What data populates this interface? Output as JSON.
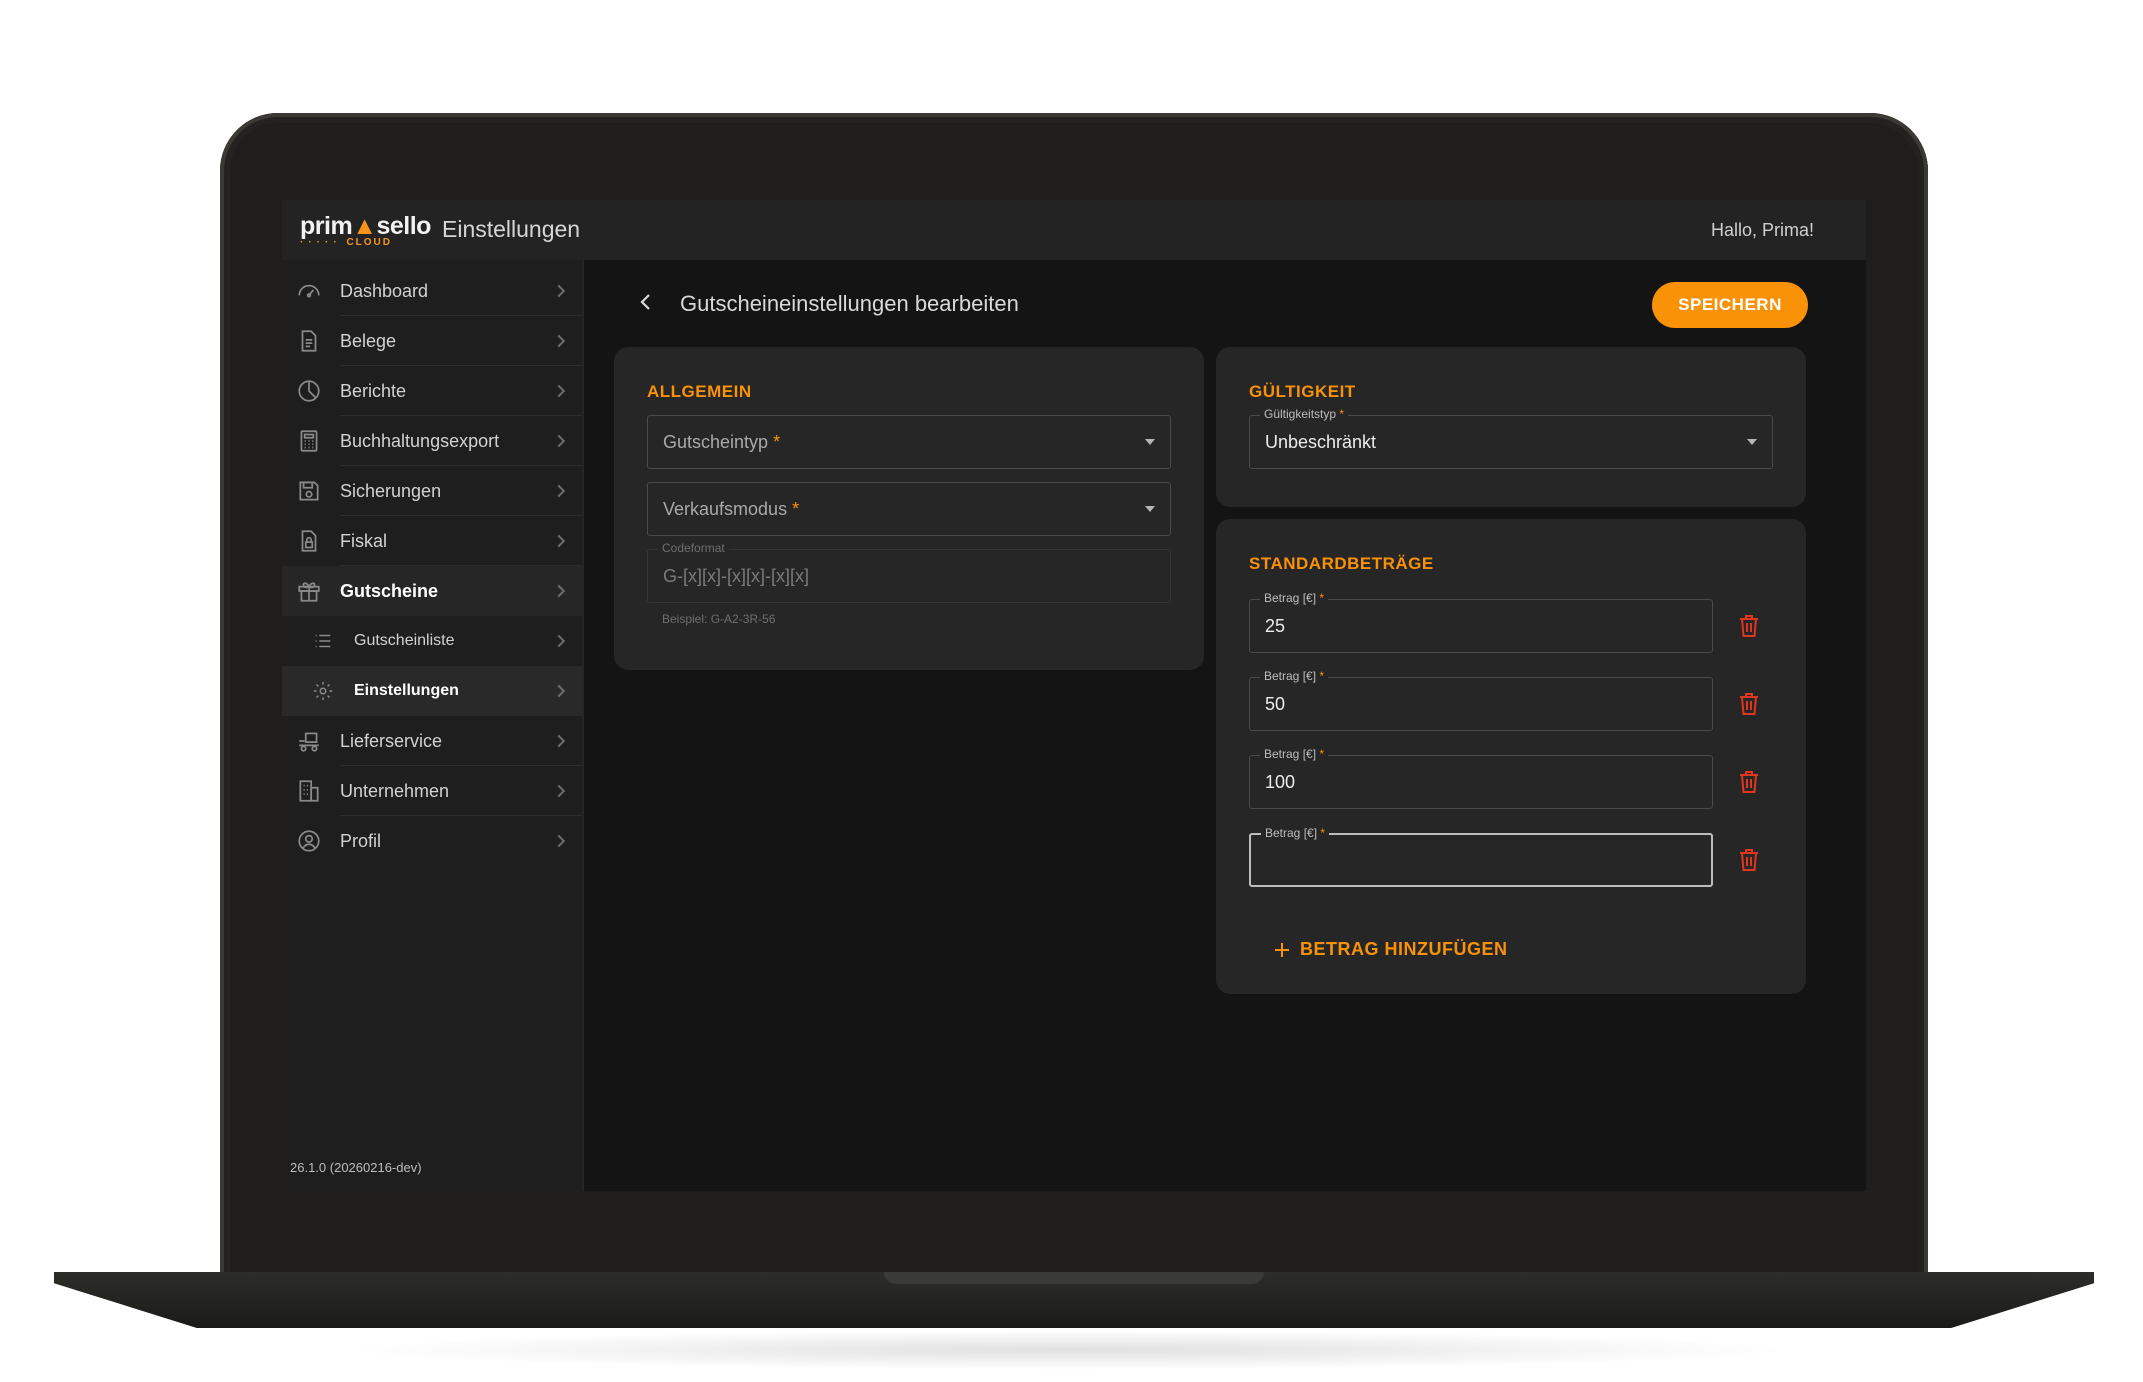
{
  "header": {
    "logo_text": "primasello",
    "logo_sub": "CLOUD",
    "app_title": "Einstellungen",
    "greeting": "Hallo, Prima!"
  },
  "sidebar": {
    "items": [
      {
        "label": "Dashboard",
        "icon": "dashboard-icon"
      },
      {
        "label": "Belege",
        "icon": "document-icon"
      },
      {
        "label": "Berichte",
        "icon": "pie-chart-icon"
      },
      {
        "label": "Buchhaltungsexport",
        "icon": "calculator-icon"
      },
      {
        "label": "Sicherungen",
        "icon": "floppy-disk-icon"
      },
      {
        "label": "Fiskal",
        "icon": "locked-document-icon"
      },
      {
        "label": "Gutscheine",
        "icon": "gift-icon"
      },
      {
        "label": "Lieferservice",
        "icon": "delivery-icon"
      },
      {
        "label": "Unternehmen",
        "icon": "building-icon"
      },
      {
        "label": "Profil",
        "icon": "user-circle-icon"
      }
    ],
    "subitems": [
      {
        "label": "Gutscheinliste",
        "icon": "list-icon"
      },
      {
        "label": "Einstellungen",
        "icon": "gear-icon"
      }
    ],
    "version": "26.1.0 (20260216-dev)"
  },
  "page": {
    "title": "Gutscheineinstellungen bearbeiten",
    "save_label": "SPEICHERN"
  },
  "allgemein": {
    "title": "ALLGEMEIN",
    "voucher_type_placeholder": "Gutscheintyp",
    "sales_mode_placeholder": "Verkaufsmodus",
    "required_mark": "*",
    "code_format_label": "Codeformat",
    "code_format_value": "G-[x][x]-[x][x]-[x][x]",
    "code_format_hint": "Beispiel: G-A2-3R-56"
  },
  "gueltigkeit": {
    "title": "GÜLTIGKEIT",
    "type_label": "Gültigkeitstyp",
    "type_value": "Unbeschränkt"
  },
  "standardbetraege": {
    "title": "STANDARDBETRÄGE",
    "amount_label": "Betrag [€]",
    "amounts": [
      "25",
      "50",
      "100",
      ""
    ],
    "add_label": "BETRAG HINZUFÜGEN"
  },
  "colors": {
    "accent": "#fa9208",
    "delete": "#e0351f",
    "background": "#141414",
    "card": "#262626",
    "sidebar": "#1e1e1e"
  }
}
